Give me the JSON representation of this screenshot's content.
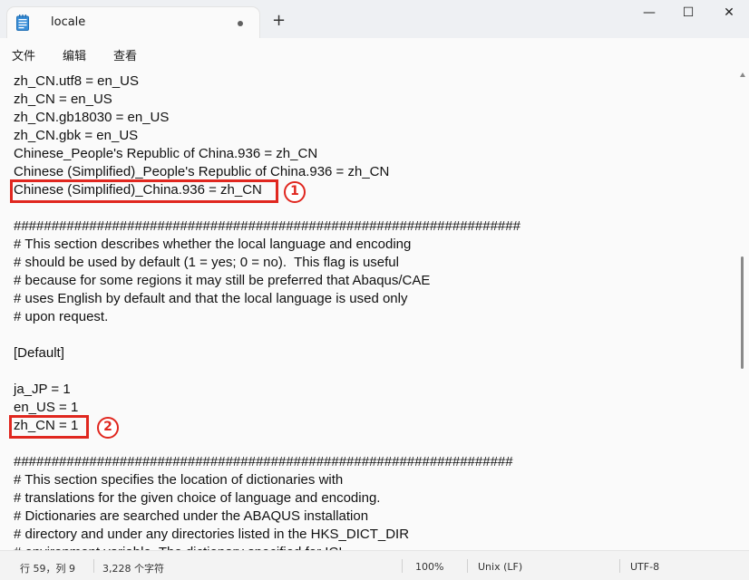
{
  "tab": {
    "title": "locale"
  },
  "window_controls": {
    "minimize": "—",
    "maximize": "☐",
    "close": "✕"
  },
  "new_tab": "+",
  "menu": {
    "file": "文件",
    "edit": "编辑",
    "view": "查看"
  },
  "editor_lines": [
    "zh_CN.utf8 = en_US",
    "zh_CN = en_US",
    "zh_CN.gb18030 = en_US",
    "zh_CN.gbk = en_US",
    "Chinese_People's Republic of China.936 = zh_CN",
    "Chinese (Simplified)_People's Republic of China.936 = zh_CN",
    "Chinese (Simplified)_China.936 = zh_CN",
    "",
    "###################################################################",
    "# This section describes whether the local language and encoding",
    "# should be used by default (1 = yes; 0 = no).  This flag is useful",
    "# because for some regions it may still be preferred that Abaqus/CAE",
    "# uses English by default and that the local language is used only",
    "# upon request.",
    "",
    "[Default]",
    "",
    "ja_JP = 1",
    "en_US = 1",
    "zh_CN = 1",
    "",
    "##################################################################",
    "# This section specifies the location of dictionaries with",
    "# translations for the given choice of language and encoding.",
    "# Dictionaries are searched under the ABAQUS installation",
    "# directory and under any directories listed in the HKS_DICT_DIR",
    "# environment variable. The dictionary specified for ICI"
  ],
  "annotations": {
    "marker1": "1",
    "marker2": "2"
  },
  "status": {
    "position": "行 59，列 9",
    "char_count": "3,228 个字符",
    "zoom": "100%",
    "line_ending": "Unix (LF)",
    "encoding": "UTF-8"
  },
  "colors": {
    "annotation_red": "#e0271f"
  },
  "icons": [
    "notepad-icon",
    "gear-icon"
  ]
}
